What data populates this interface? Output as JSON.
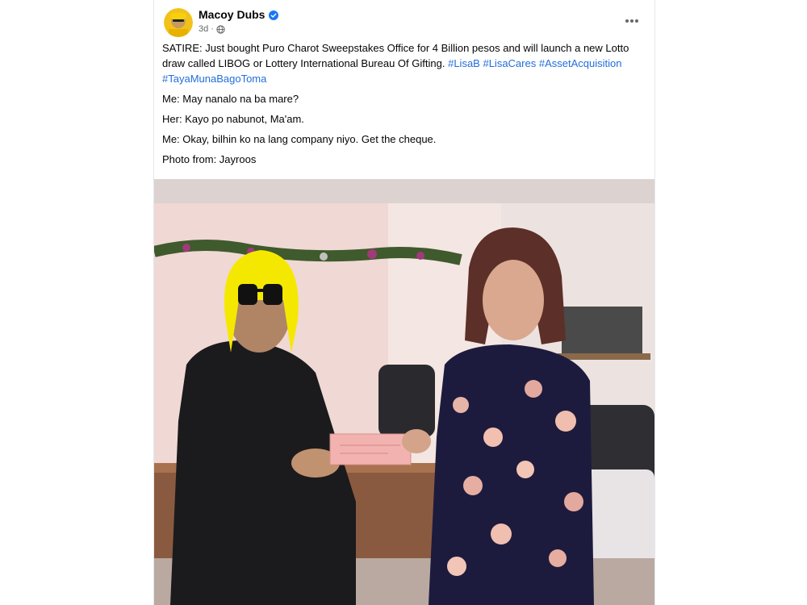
{
  "post": {
    "author": "Macoy Dubs",
    "timestamp": "3d",
    "separator": "·",
    "body": {
      "line1_text": "SATIRE: Just bought Puro Charot Sweepstakes Office for 4 Billion pesos and will launch a new Lotto draw called LIBOG or Lottery International Bureau Of Gifting.",
      "hashtags": [
        "#LisaB",
        "#LisaCares",
        "#AssetAcquisition",
        "#TayaMunaBagoToma"
      ],
      "lines": [
        "Me: May nanalo na ba mare?",
        "Her: Kayo po nabunot, Ma'am.",
        "Me: Okay, bilhin ko na lang company niyo. Get the cheque.",
        "Photo from: Jayroos"
      ]
    },
    "icons": {
      "verified": "verified-badge-icon",
      "audience": "globe-icon",
      "menu": "more-options-icon"
    },
    "colors": {
      "hashtag": "#216fdb",
      "verified": "#1877f2",
      "secondary_text": "#65676b"
    }
  }
}
